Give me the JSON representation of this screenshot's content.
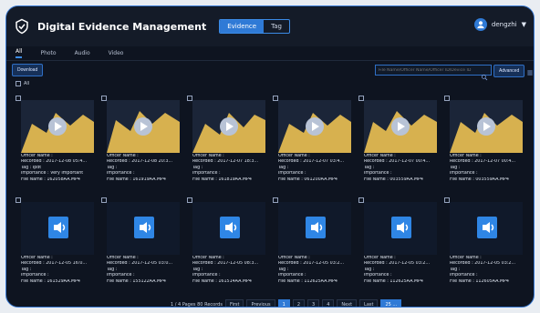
{
  "header": {
    "app_title": "Digital Evidence Management",
    "segments": [
      "Evidence",
      "Tag"
    ],
    "active_segment": "Evidence",
    "user": "dengzhi",
    "user_dropdown_icon": "chevron-down-icon"
  },
  "tabs": [
    "All",
    "Photo",
    "Audio",
    "Video"
  ],
  "active_tab": "All",
  "toolbar": {
    "download_label": "Download",
    "search_placeholder": "File Name/Officer Name/Officer ID/Device ID",
    "advanced_label": "Advanced"
  },
  "select_all_label": "All",
  "cards": [
    {
      "kind": "video",
      "officer": "Officer Name :",
      "recorded": "Recorded : 2017-12-08 05:4...",
      "tag": "Tag : Ipdt",
      "importance": "Importance : Very Important",
      "file": "File Name : 162058AA.MP4"
    },
    {
      "kind": "video",
      "officer": "Officer Name :",
      "recorded": "Recorded : 2017-12-08 20:3...",
      "tag": "Tag :",
      "importance": "Importance :",
      "file": "File Name : 161919AA.MP4"
    },
    {
      "kind": "video",
      "officer": "Officer Name :",
      "recorded": "Recorded : 2017-12-07 18:3...",
      "tag": "Tag :",
      "importance": "Importance :",
      "file": "File Name : 161819AA.MP4"
    },
    {
      "kind": "video",
      "officer": "Officer Name :",
      "recorded": "Recorded : 2017-12-07 03:4...",
      "tag": "Tag :",
      "importance": "Importance :",
      "file": "File Name : 061200AA.MP4"
    },
    {
      "kind": "video",
      "officer": "Officer Name :",
      "recorded": "Recorded : 2017-12-07 00:4...",
      "tag": "Tag :",
      "importance": "Importance :",
      "file": "File Name : 003559AA.MP4"
    },
    {
      "kind": "video",
      "officer": "Officer Name :",
      "recorded": "Recorded : 2017-12-07 00:4...",
      "tag": "Tag :",
      "importance": "Importance :",
      "file": "File Name : 003559AA.MP4"
    },
    {
      "kind": "audio",
      "officer": "Officer Name :",
      "recorded": "Recorded : 2017-12-05 16:0...",
      "tag": "Tag :",
      "importance": "Importance :",
      "file": "File Name : 161529AA.MP4"
    },
    {
      "kind": "audio",
      "officer": "Officer Name :",
      "recorded": "Recorded : 2017-12-05 03:0...",
      "tag": "Tag :",
      "importance": "Importance :",
      "file": "File Name : 155122AA.MP4"
    },
    {
      "kind": "audio",
      "officer": "Officer Name :",
      "recorded": "Recorded : 2017-12-05 08:3...",
      "tag": "Tag :",
      "importance": "Importance :",
      "file": "File Name : 161514AA.MP4"
    },
    {
      "kind": "audio",
      "officer": "Officer Name :",
      "recorded": "Recorded : 2017-12-05 03:2...",
      "tag": "Tag :",
      "importance": "Importance :",
      "file": "File Name : 112625AA.MP4"
    },
    {
      "kind": "audio",
      "officer": "Officer Name :",
      "recorded": "Recorded : 2017-12-05 03:2...",
      "tag": "Tag :",
      "importance": "Importance :",
      "file": "File Name : 112625AA.MP4"
    },
    {
      "kind": "audio",
      "officer": "Officer Name :",
      "recorded": "Recorded : 2017-12-05 03:2...",
      "tag": "Tag :",
      "importance": "Importance :",
      "file": "File Name : 112605AA.MP4"
    }
  ],
  "pagination": {
    "summary": "1 / 4 Pages 80 Records",
    "first": "First",
    "previous": "Previous",
    "pages": [
      "1",
      "2",
      "3",
      "4"
    ],
    "active_page": "1",
    "next": "Next",
    "last": "Last",
    "per_page": "25 ..."
  },
  "colors": {
    "accent": "#2f7ad6",
    "frame_border": "#3a7bd5"
  }
}
